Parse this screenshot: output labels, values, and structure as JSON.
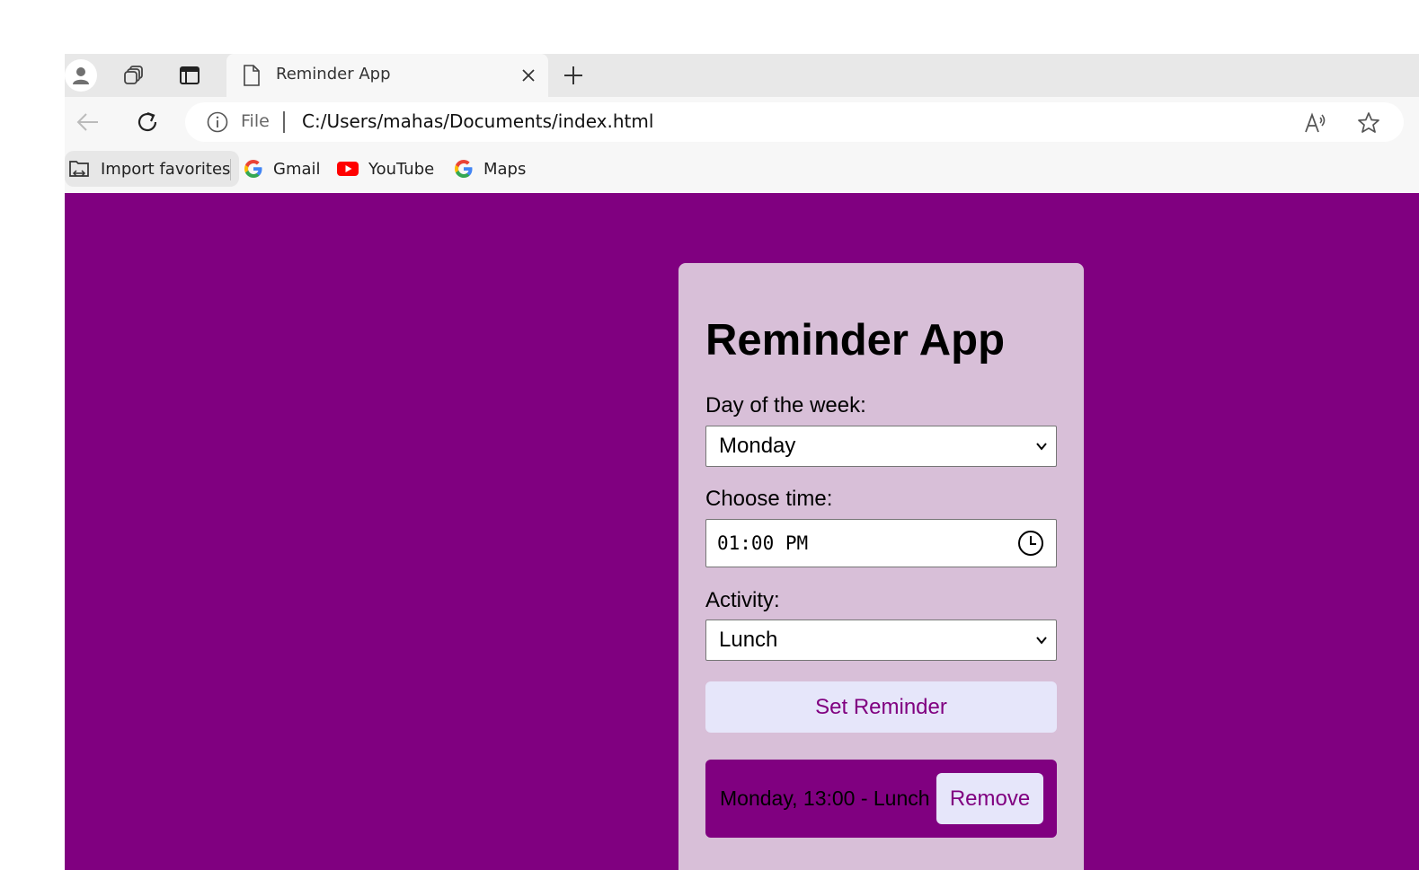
{
  "browser": {
    "tab": {
      "title": "Reminder App"
    },
    "address_bar": {
      "scheme_label": "File",
      "url": "C:/Users/mahas/Documents/index.html"
    },
    "favorites": [
      {
        "label": "Import favorites",
        "icon": "import-folder-icon"
      },
      {
        "label": "Gmail",
        "icon": "google-g-icon"
      },
      {
        "label": "YouTube",
        "icon": "youtube-icon"
      },
      {
        "label": "Maps",
        "icon": "google-g-icon"
      }
    ]
  },
  "app": {
    "title": "Reminder App",
    "day_label": "Day of the week:",
    "day_value": "Monday",
    "time_label": "Choose time:",
    "time_value": "01:00 PM",
    "activity_label": "Activity:",
    "activity_value": "Lunch",
    "set_button": "Set Reminder",
    "reminders": [
      {
        "text": "Monday, 13:00 - Lunch",
        "remove_label": "Remove"
      }
    ]
  },
  "colors": {
    "page_background": "#800080",
    "card_background": "#d8bfd8",
    "button_background": "#e6e6fa",
    "button_text": "#800080"
  }
}
